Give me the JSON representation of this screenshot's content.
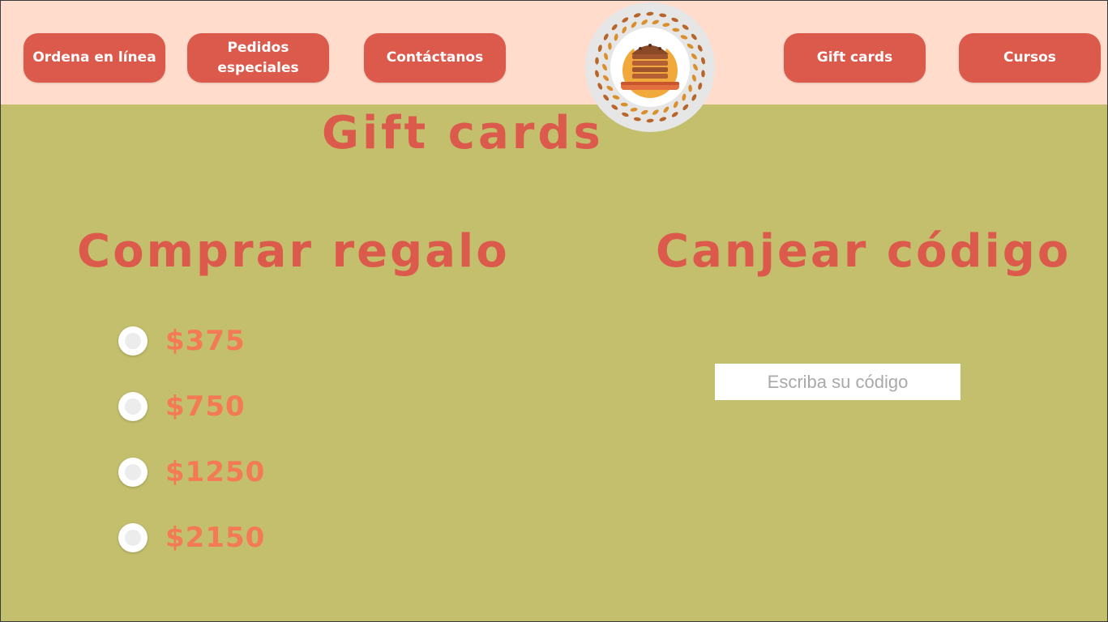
{
  "header": {
    "nav_left": [
      {
        "label": "Ordena en línea"
      },
      {
        "label": "Pedidos especiales"
      },
      {
        "label": "Contáctanos"
      }
    ],
    "nav_right": [
      {
        "label": "Gift cards"
      },
      {
        "label": "Cursos"
      }
    ],
    "logo_icon": "bakery-cupcake-wreath-logo"
  },
  "page": {
    "title": "Gift cards"
  },
  "buy_section": {
    "title": "Comprar regalo",
    "options": [
      {
        "label": "$375",
        "selected": false
      },
      {
        "label": "$750",
        "selected": false
      },
      {
        "label": "$1250",
        "selected": false
      },
      {
        "label": "$2150",
        "selected": false
      }
    ]
  },
  "redeem_section": {
    "title": "Canjear código",
    "input_value": "",
    "input_placeholder": "Escriba su código"
  },
  "colors": {
    "page_background": "#c3bf6c",
    "header_background": "#ffdccb",
    "accent_red": "#db5a4c",
    "option_text": "#f47a55"
  }
}
